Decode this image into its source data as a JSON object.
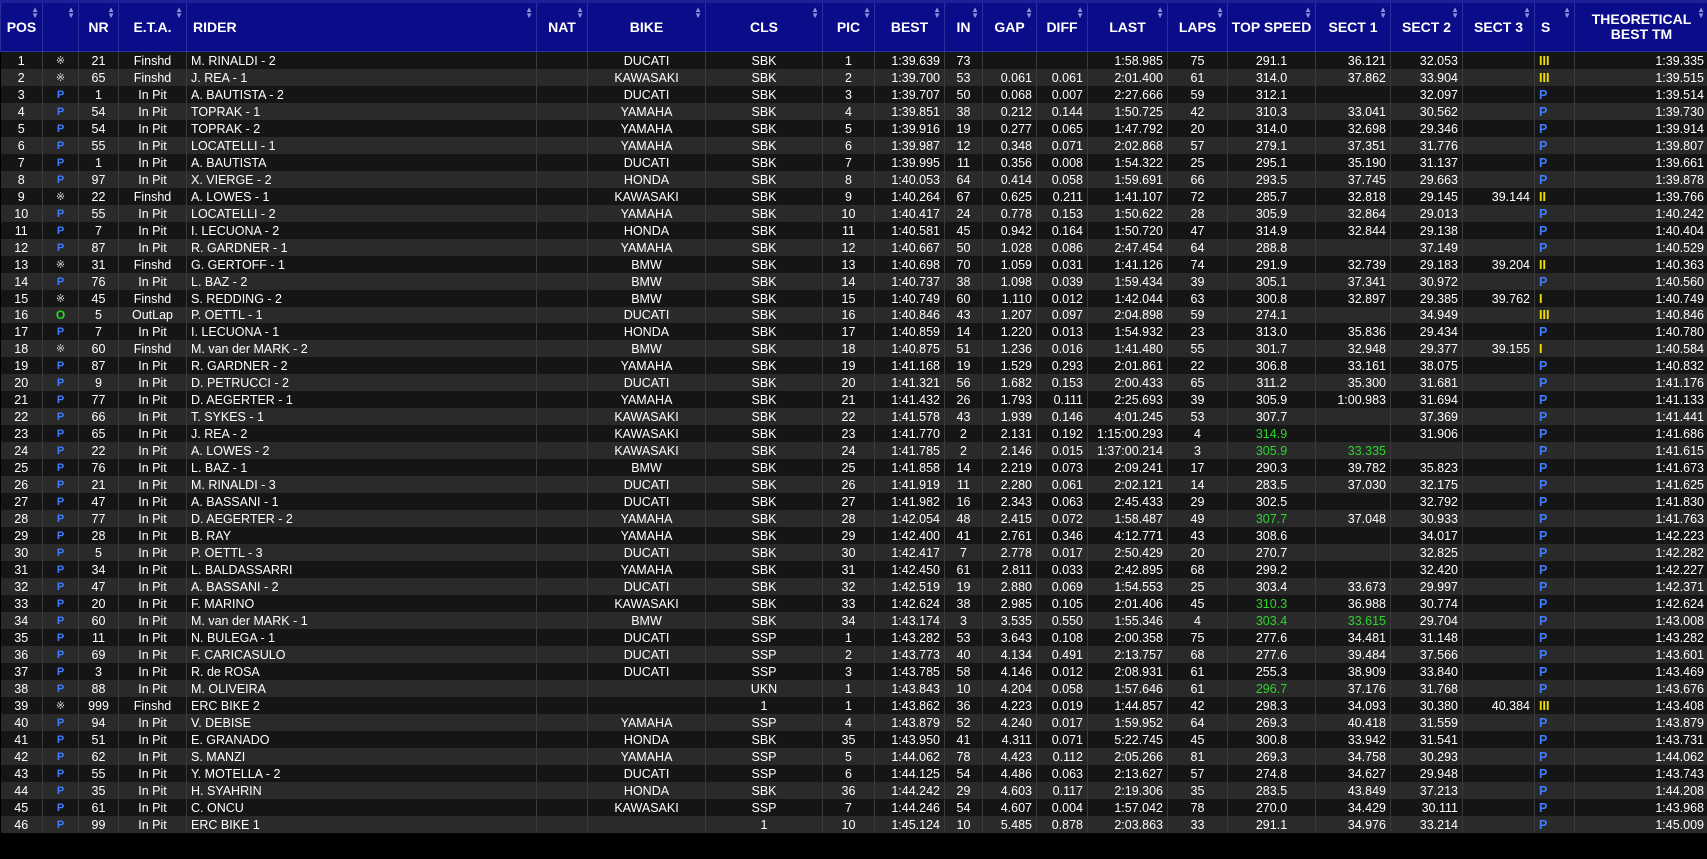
{
  "columns": [
    {
      "key": "pos",
      "label": "POS",
      "w": 42,
      "align": "c"
    },
    {
      "key": "st",
      "label": "",
      "w": 36,
      "align": "c"
    },
    {
      "key": "nr",
      "label": "NR",
      "w": 40,
      "align": "c"
    },
    {
      "key": "eta",
      "label": "E.T.A.",
      "w": 68,
      "align": "c"
    },
    {
      "key": "rider",
      "label": "RIDER",
      "w": 350,
      "align": "l"
    },
    {
      "key": "nat",
      "label": "NAT",
      "w": 51,
      "align": "c"
    },
    {
      "key": "bike",
      "label": "BIKE",
      "w": 118,
      "align": "c"
    },
    {
      "key": "cls",
      "label": "CLS",
      "w": 117,
      "align": "c"
    },
    {
      "key": "pic",
      "label": "PIC",
      "w": 52,
      "align": "c"
    },
    {
      "key": "best",
      "label": "BEST",
      "w": 70,
      "align": "r"
    },
    {
      "key": "in",
      "label": "IN",
      "w": 38,
      "align": "c"
    },
    {
      "key": "gap",
      "label": "GAP",
      "w": 54,
      "align": "r"
    },
    {
      "key": "diff",
      "label": "DIFF",
      "w": 51,
      "align": "r"
    },
    {
      "key": "last",
      "label": "LAST",
      "w": 80,
      "align": "r"
    },
    {
      "key": "laps",
      "label": "LAPS",
      "w": 60,
      "align": "c"
    },
    {
      "key": "speed",
      "label": "TOP SPEED",
      "w": 88,
      "align": "c"
    },
    {
      "key": "s1",
      "label": "SECT 1",
      "w": 75,
      "align": "r"
    },
    {
      "key": "s2",
      "label": "SECT 2",
      "w": 72,
      "align": "r"
    },
    {
      "key": "s3",
      "label": "SECT 3",
      "w": 72,
      "align": "r"
    },
    {
      "key": "s",
      "label": "S",
      "w": 40,
      "align": "l"
    },
    {
      "key": "theo",
      "label": "THEORETICAL BEST TM",
      "w": 134,
      "align": "r"
    }
  ],
  "rows": [
    [
      "1",
      "F",
      "21",
      "Finshd",
      "M. RINALDI - 2",
      "",
      "DUCATI",
      "SBK",
      "1",
      "1:39.639",
      "73",
      "",
      "",
      "1:58.985",
      "75",
      "291.1",
      "36.121",
      "32.053",
      "",
      "III",
      "1:39.335"
    ],
    [
      "2",
      "F",
      "65",
      "Finshd",
      "J. REA - 1",
      "",
      "KAWASAKI",
      "SBK",
      "2",
      "1:39.700",
      "53",
      "0.061",
      "0.061",
      "2:01.400",
      "61",
      "314.0",
      "37.862",
      "33.904",
      "",
      "III",
      "1:39.515"
    ],
    [
      "3",
      "P",
      "1",
      "In Pit",
      "A. BAUTISTA - 2",
      "",
      "DUCATI",
      "SBK",
      "3",
      "1:39.707",
      "50",
      "0.068",
      "0.007",
      "2:27.666",
      "59",
      "312.1",
      "",
      "32.097",
      "",
      "P",
      "1:39.514"
    ],
    [
      "4",
      "P",
      "54",
      "In Pit",
      "TOPRAK - 1",
      "",
      "YAMAHA",
      "SBK",
      "4",
      "1:39.851",
      "38",
      "0.212",
      "0.144",
      "1:50.725",
      "42",
      "310.3",
      "33.041",
      "30.562",
      "",
      "P",
      "1:39.730"
    ],
    [
      "5",
      "P",
      "54",
      "In Pit",
      "TOPRAK - 2",
      "",
      "YAMAHA",
      "SBK",
      "5",
      "1:39.916",
      "19",
      "0.277",
      "0.065",
      "1:47.792",
      "20",
      "314.0",
      "32.698",
      "29.346",
      "",
      "P",
      "1:39.914"
    ],
    [
      "6",
      "P",
      "55",
      "In Pit",
      "LOCATELLI - 1",
      "",
      "YAMAHA",
      "SBK",
      "6",
      "1:39.987",
      "12",
      "0.348",
      "0.071",
      "2:02.868",
      "57",
      "279.1",
      "37.351",
      "31.776",
      "",
      "P",
      "1:39.807"
    ],
    [
      "7",
      "P",
      "1",
      "In Pit",
      "A. BAUTISTA",
      "",
      "DUCATI",
      "SBK",
      "7",
      "1:39.995",
      "11",
      "0.356",
      "0.008",
      "1:54.322",
      "25",
      "295.1",
      "35.190",
      "31.137",
      "",
      "P",
      "1:39.661"
    ],
    [
      "8",
      "P",
      "97",
      "In Pit",
      "X. VIERGE - 2",
      "",
      "HONDA",
      "SBK",
      "8",
      "1:40.053",
      "64",
      "0.414",
      "0.058",
      "1:59.691",
      "66",
      "293.5",
      "37.745",
      "29.663",
      "",
      "P",
      "1:39.878"
    ],
    [
      "9",
      "F",
      "22",
      "Finshd",
      "A. LOWES - 1",
      "",
      "KAWASAKI",
      "SBK",
      "9",
      "1:40.264",
      "67",
      "0.625",
      "0.211",
      "1:41.107",
      "72",
      "285.7",
      "32.818",
      "29.145",
      "39.144",
      "II",
      "1:39.766"
    ],
    [
      "10",
      "P",
      "55",
      "In Pit",
      "LOCATELLI - 2",
      "",
      "YAMAHA",
      "SBK",
      "10",
      "1:40.417",
      "24",
      "0.778",
      "0.153",
      "1:50.622",
      "28",
      "305.9",
      "32.864",
      "29.013",
      "",
      "P",
      "1:40.242"
    ],
    [
      "11",
      "P",
      "7",
      "In Pit",
      "I. LECUONA - 2",
      "",
      "HONDA",
      "SBK",
      "11",
      "1:40.581",
      "45",
      "0.942",
      "0.164",
      "1:50.720",
      "47",
      "314.9",
      "32.844",
      "29.138",
      "",
      "P",
      "1:40.404"
    ],
    [
      "12",
      "P",
      "87",
      "In Pit",
      "R. GARDNER - 1",
      "",
      "YAMAHA",
      "SBK",
      "12",
      "1:40.667",
      "50",
      "1.028",
      "0.086",
      "2:47.454",
      "64",
      "288.8",
      "",
      "37.149",
      "",
      "P",
      "1:40.529"
    ],
    [
      "13",
      "F",
      "31",
      "Finshd",
      "G. GERTOFF - 1",
      "",
      "BMW",
      "SBK",
      "13",
      "1:40.698",
      "70",
      "1.059",
      "0.031",
      "1:41.126",
      "74",
      "291.9",
      "32.739",
      "29.183",
      "39.204",
      "II",
      "1:40.363"
    ],
    [
      "14",
      "P",
      "76",
      "In Pit",
      "L. BAZ - 2",
      "",
      "BMW",
      "SBK",
      "14",
      "1:40.737",
      "38",
      "1.098",
      "0.039",
      "1:59.434",
      "39",
      "305.1",
      "37.341",
      "30.972",
      "",
      "P",
      "1:40.560"
    ],
    [
      "15",
      "F",
      "45",
      "Finshd",
      "S. REDDING - 2",
      "",
      "BMW",
      "SBK",
      "15",
      "1:40.749",
      "60",
      "1.110",
      "0.012",
      "1:42.044",
      "63",
      "300.8",
      "32.897",
      "29.385",
      "39.762",
      "I",
      "1:40.749"
    ],
    [
      "16",
      "O",
      "5",
      "OutLap",
      "P. OETTL - 1",
      "",
      "DUCATI",
      "SBK",
      "16",
      "1:40.846",
      "43",
      "1.207",
      "0.097",
      "2:04.898",
      "59",
      "274.1",
      "",
      "34.949",
      "",
      "III",
      "1:40.846"
    ],
    [
      "17",
      "P",
      "7",
      "In Pit",
      "I. LECUONA - 1",
      "",
      "HONDA",
      "SBK",
      "17",
      "1:40.859",
      "14",
      "1.220",
      "0.013",
      "1:54.932",
      "23",
      "313.0",
      "35.836",
      "29.434",
      "",
      "P",
      "1:40.780"
    ],
    [
      "18",
      "F",
      "60",
      "Finshd",
      "M. van der MARK - 2",
      "",
      "BMW",
      "SBK",
      "18",
      "1:40.875",
      "51",
      "1.236",
      "0.016",
      "1:41.480",
      "55",
      "301.7",
      "32.948",
      "29.377",
      "39.155",
      "I",
      "1:40.584"
    ],
    [
      "19",
      "P",
      "87",
      "In Pit",
      "R. GARDNER - 2",
      "",
      "YAMAHA",
      "SBK",
      "19",
      "1:41.168",
      "19",
      "1.529",
      "0.293",
      "2:01.861",
      "22",
      "306.8",
      "33.161",
      "38.075",
      "",
      "P",
      "1:40.832"
    ],
    [
      "20",
      "P",
      "9",
      "In Pit",
      "D. PETRUCCI - 2",
      "",
      "DUCATI",
      "SBK",
      "20",
      "1:41.321",
      "56",
      "1.682",
      "0.153",
      "2:00.433",
      "65",
      "311.2",
      "35.300",
      "31.681",
      "",
      "P",
      "1:41.176"
    ],
    [
      "21",
      "P",
      "77",
      "In Pit",
      "D. AEGERTER - 1",
      "",
      "YAMAHA",
      "SBK",
      "21",
      "1:41.432",
      "26",
      "1.793",
      "0.111",
      "2:25.693",
      "39",
      "305.9",
      "1:00.983",
      "31.694",
      "",
      "P",
      "1:41.133"
    ],
    [
      "22",
      "P",
      "66",
      "In Pit",
      "T. SYKES - 1",
      "",
      "KAWASAKI",
      "SBK",
      "22",
      "1:41.578",
      "43",
      "1.939",
      "0.146",
      "4:01.245",
      "53",
      "307.7",
      "",
      "37.369",
      "",
      "P",
      "1:41.441"
    ],
    [
      "23",
      "P",
      "65",
      "In Pit",
      "J. REA - 2",
      "",
      "KAWASAKI",
      "SBK",
      "23",
      "1:41.770",
      "2",
      "2.131",
      "0.192",
      "1:15:00.293",
      "4",
      "314.9",
      "",
      "31.906",
      "",
      "P",
      "1:41.686"
    ],
    [
      "24",
      "P",
      "22",
      "In Pit",
      "A. LOWES - 2",
      "",
      "KAWASAKI",
      "SBK",
      "24",
      "1:41.785",
      "2",
      "2.146",
      "0.015",
      "1:37:00.214",
      "3",
      "305.9",
      "33.335",
      "",
      "",
      "P",
      "1:41.615"
    ],
    [
      "25",
      "P",
      "76",
      "In Pit",
      "L. BAZ - 1",
      "",
      "BMW",
      "SBK",
      "25",
      "1:41.858",
      "14",
      "2.219",
      "0.073",
      "2:09.241",
      "17",
      "290.3",
      "39.782",
      "35.823",
      "",
      "P",
      "1:41.673"
    ],
    [
      "26",
      "P",
      "21",
      "In Pit",
      "M. RINALDI - 3",
      "",
      "DUCATI",
      "SBK",
      "26",
      "1:41.919",
      "11",
      "2.280",
      "0.061",
      "2:02.121",
      "14",
      "283.5",
      "37.030",
      "32.175",
      "",
      "P",
      "1:41.625"
    ],
    [
      "27",
      "P",
      "47",
      "In Pit",
      "A. BASSANI - 1",
      "",
      "DUCATI",
      "SBK",
      "27",
      "1:41.982",
      "16",
      "2.343",
      "0.063",
      "2:45.433",
      "29",
      "302.5",
      "",
      "32.792",
      "",
      "P",
      "1:41.830"
    ],
    [
      "28",
      "P",
      "77",
      "In Pit",
      "D. AEGERTER - 2",
      "",
      "YAMAHA",
      "SBK",
      "28",
      "1:42.054",
      "48",
      "2.415",
      "0.072",
      "1:58.487",
      "49",
      "307.7",
      "37.048",
      "30.933",
      "",
      "P",
      "1:41.763"
    ],
    [
      "29",
      "P",
      "28",
      "In Pit",
      "B. RAY",
      "",
      "YAMAHA",
      "SBK",
      "29",
      "1:42.400",
      "41",
      "2.761",
      "0.346",
      "4:12.771",
      "43",
      "308.6",
      "",
      "34.017",
      "",
      "P",
      "1:42.223"
    ],
    [
      "30",
      "P",
      "5",
      "In Pit",
      "P. OETTL - 3",
      "",
      "DUCATI",
      "SBK",
      "30",
      "1:42.417",
      "7",
      "2.778",
      "0.017",
      "2:50.429",
      "20",
      "270.7",
      "",
      "32.825",
      "",
      "P",
      "1:42.282"
    ],
    [
      "31",
      "P",
      "34",
      "In Pit",
      "L. BALDASSARRI",
      "",
      "YAMAHA",
      "SBK",
      "31",
      "1:42.450",
      "61",
      "2.811",
      "0.033",
      "2:42.895",
      "68",
      "299.2",
      "",
      "32.420",
      "",
      "P",
      "1:42.227"
    ],
    [
      "32",
      "P",
      "47",
      "In Pit",
      "A. BASSANI - 2",
      "",
      "DUCATI",
      "SBK",
      "32",
      "1:42.519",
      "19",
      "2.880",
      "0.069",
      "1:54.553",
      "25",
      "303.4",
      "33.673",
      "29.997",
      "",
      "P",
      "1:42.371"
    ],
    [
      "33",
      "P",
      "20",
      "In Pit",
      "F. MARINO",
      "",
      "KAWASAKI",
      "SBK",
      "33",
      "1:42.624",
      "38",
      "2.985",
      "0.105",
      "2:01.406",
      "45",
      "310.3",
      "36.988",
      "30.774",
      "",
      "P",
      "1:42.624"
    ],
    [
      "34",
      "P",
      "60",
      "In Pit",
      "M. van der MARK - 1",
      "",
      "BMW",
      "SBK",
      "34",
      "1:43.174",
      "3",
      "3.535",
      "0.550",
      "1:55.346",
      "4",
      "303.4",
      "33.615",
      "29.704",
      "",
      "P",
      "1:43.008"
    ],
    [
      "35",
      "P",
      "11",
      "In Pit",
      "N. BULEGA - 1",
      "",
      "DUCATI",
      "SSP",
      "1",
      "1:43.282",
      "53",
      "3.643",
      "0.108",
      "2:00.358",
      "75",
      "277.6",
      "34.481",
      "31.148",
      "",
      "P",
      "1:43.282"
    ],
    [
      "36",
      "P",
      "69",
      "In Pit",
      "F. CARICASULO",
      "",
      "DUCATI",
      "SSP",
      "2",
      "1:43.773",
      "40",
      "4.134",
      "0.491",
      "2:13.757",
      "68",
      "277.6",
      "39.484",
      "37.566",
      "",
      "P",
      "1:43.601"
    ],
    [
      "37",
      "P",
      "3",
      "In Pit",
      "R. de ROSA",
      "",
      "DUCATI",
      "SSP",
      "3",
      "1:43.785",
      "58",
      "4.146",
      "0.012",
      "2:08.931",
      "61",
      "255.3",
      "38.909",
      "33.840",
      "",
      "P",
      "1:43.469"
    ],
    [
      "38",
      "P",
      "88",
      "In Pit",
      "M. OLIVEIRA",
      "",
      "",
      "UKN",
      "1",
      "1:43.843",
      "10",
      "4.204",
      "0.058",
      "1:57.646",
      "61",
      "296.7",
      "37.176",
      "31.768",
      "",
      "P",
      "1:43.676"
    ],
    [
      "39",
      "F",
      "999",
      "Finshd",
      "ERC BIKE 2",
      "",
      "",
      "1",
      "1",
      "1:43.862",
      "36",
      "4.223",
      "0.019",
      "1:44.857",
      "42",
      "298.3",
      "34.093",
      "30.380",
      "40.384",
      "III",
      "1:43.408"
    ],
    [
      "40",
      "P",
      "94",
      "In Pit",
      "V. DEBISE",
      "",
      "YAMAHA",
      "SSP",
      "4",
      "1:43.879",
      "52",
      "4.240",
      "0.017",
      "1:59.952",
      "64",
      "269.3",
      "40.418",
      "31.559",
      "",
      "P",
      "1:43.879"
    ],
    [
      "41",
      "P",
      "51",
      "In Pit",
      "E. GRANADO",
      "",
      "HONDA",
      "SBK",
      "35",
      "1:43.950",
      "41",
      "4.311",
      "0.071",
      "5:22.745",
      "45",
      "300.8",
      "33.942",
      "31.541",
      "",
      "P",
      "1:43.731"
    ],
    [
      "42",
      "P",
      "62",
      "In Pit",
      "S. MANZI",
      "",
      "YAMAHA",
      "SSP",
      "5",
      "1:44.062",
      "78",
      "4.423",
      "0.112",
      "2:05.266",
      "81",
      "269.3",
      "34.758",
      "30.293",
      "",
      "P",
      "1:44.062"
    ],
    [
      "43",
      "P",
      "55",
      "In Pit",
      "Y. MOTELLA - 2",
      "",
      "DUCATI",
      "SSP",
      "6",
      "1:44.125",
      "54",
      "4.486",
      "0.063",
      "2:13.627",
      "57",
      "274.8",
      "34.627",
      "29.948",
      "",
      "P",
      "1:43.743"
    ],
    [
      "44",
      "P",
      "35",
      "In Pit",
      "H. SYAHRIN",
      "",
      "HONDA",
      "SBK",
      "36",
      "1:44.242",
      "29",
      "4.603",
      "0.117",
      "2:19.306",
      "35",
      "283.5",
      "43.849",
      "37.213",
      "",
      "P",
      "1:44.208"
    ],
    [
      "45",
      "P",
      "61",
      "In Pit",
      "C. ONCU",
      "",
      "KAWASAKI",
      "SSP",
      "7",
      "1:44.246",
      "54",
      "4.607",
      "0.004",
      "1:57.042",
      "78",
      "270.0",
      "34.429",
      "30.111",
      "",
      "P",
      "1:43.968"
    ],
    [
      "46",
      "P",
      "99",
      "In Pit",
      "ERC BIKE 1",
      "",
      "",
      "1",
      "10",
      "1:45.124",
      "10",
      "5.485",
      "0.878",
      "2:03.863",
      "33",
      "291.1",
      "34.976",
      "33.214",
      "",
      "P",
      "1:45.009"
    ]
  ],
  "highlights": [
    {
      "row": 23,
      "col": 15
    },
    {
      "row": 24,
      "col": 15
    },
    {
      "row": 24,
      "col": 16
    },
    {
      "row": 28,
      "col": 15
    },
    {
      "row": 33,
      "col": 15
    },
    {
      "row": 34,
      "col": 15
    },
    {
      "row": 34,
      "col": 16
    },
    {
      "row": 38,
      "col": 15
    }
  ],
  "status_icons": {
    "P": "P",
    "F": "※",
    "O": "O"
  },
  "colors": {
    "header_bg": "#0a0c8a",
    "pit_blue": "#3f7cff",
    "sector_yellow": "#f0e000",
    "best_green": "#2fd42f",
    "outlap_green": "#27d827"
  }
}
